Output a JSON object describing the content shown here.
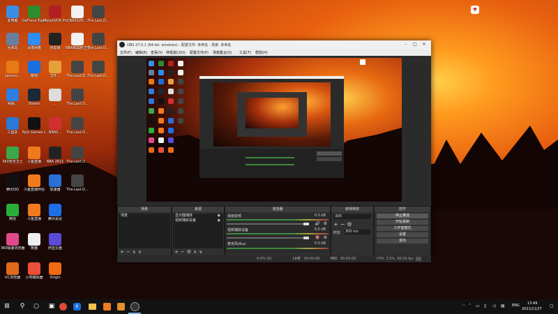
{
  "desktop": {
    "icons": [
      {
        "label": "此电脑",
        "icon": "computer-icon",
        "color": "#3a8ee6"
      },
      {
        "label": "GeForce Experience",
        "icon": "nvidia-icon",
        "color": "#2e8b2e"
      },
      {
        "label": "MorphVOX Pro",
        "icon": "morphvox-icon",
        "color": "#b02020"
      },
      {
        "label": "CBA2020-...",
        "icon": "file-icon",
        "color": "#f2f2f2"
      },
      {
        "label": "The.Last.D...",
        "icon": "video-file-icon",
        "color": "#444444"
      },
      {
        "label": "回收站",
        "icon": "recycle-bin-icon",
        "color": "#6a7fa0"
      },
      {
        "label": "百度网盘",
        "icon": "baidu-netdisk-icon",
        "color": "#2f8cf0"
      },
      {
        "label": "快剪辑",
        "icon": "kuaijianji-icon",
        "color": "#222222"
      },
      {
        "label": "NBA和其他卫生",
        "icon": "file-icon",
        "color": "#f2f2f2"
      },
      {
        "label": "The.Last.D...",
        "icon": "video-file-icon",
        "color": "#444444"
      },
      {
        "label": "Lenovo...",
        "icon": "app-icon",
        "color": "#e87a14"
      },
      {
        "label": "酷狗",
        "icon": "kugou-icon",
        "color": "#1a6fe0"
      },
      {
        "label": "文件...",
        "icon": "app-icon",
        "color": "#e6a03a"
      },
      {
        "label": "The.Last.D...",
        "icon": "video-file-icon",
        "color": "#444444"
      },
      {
        "label": "The.Last.D...",
        "icon": "video-file-icon",
        "color": "#444444"
      },
      {
        "label": "网易...",
        "icon": "app-icon",
        "color": "#2f7de0"
      },
      {
        "label": "Steam",
        "icon": "steam-icon",
        "color": "#1b2838"
      },
      {
        "label": "...",
        "icon": "anime-icon",
        "color": "#dddddd"
      },
      {
        "label": "The.Last.D...",
        "icon": "video-file-icon",
        "color": "#444444"
      },
      {
        "label": "三国杀",
        "icon": "app-icon",
        "color": "#2b78d6"
      },
      {
        "label": "Epic Games Launcher",
        "icon": "epic-icon",
        "color": "#111111"
      },
      {
        "label": "NBA2...",
        "icon": "app-icon",
        "color": "#d03030"
      },
      {
        "label": "The.Last.D...",
        "icon": "video-file-icon",
        "color": "#444444"
      },
      {
        "label": "360安全卫士",
        "icon": "360-icon",
        "color": "#3aa84a"
      },
      {
        "label": "斗鱼直播",
        "icon": "douyu-icon",
        "color": "#f07a1e"
      },
      {
        "label": "NBA 2K21",
        "icon": "nba2k-icon",
        "color": "#222222"
      },
      {
        "label": "The.Last.D...",
        "icon": "video-file-icon",
        "color": "#444444"
      },
      {
        "label": "腾讯QQ",
        "icon": "qq-icon",
        "color": "#111111"
      },
      {
        "label": "斗鱼直播伴侣",
        "icon": "douyu-icon",
        "color": "#f07a1e"
      },
      {
        "label": "加速器",
        "icon": "app-icon",
        "color": "#2a6fd8"
      },
      {
        "label": "The.Last.D...",
        "icon": "video-file-icon",
        "color": "#444444"
      },
      {
        "label": "微信",
        "icon": "wechat-icon",
        "color": "#2aae3a"
      },
      {
        "label": "斗鱼直播",
        "icon": "douyu-icon",
        "color": "#f07a1e"
      },
      {
        "label": "腾讯会议",
        "icon": "tencent-meeting-icon",
        "color": "#1e6ee6"
      },
      {
        "label": "360极速浏览器",
        "icon": "360-browser-icon",
        "color": "#e04a8a"
      },
      {
        "label": "熊猫",
        "icon": "panda-icon",
        "color": "#eeeeee"
      },
      {
        "label": "阿里云盘",
        "icon": "aliyun-icon",
        "color": "#5a4ad6"
      },
      {
        "label": "UC浏览器",
        "icon": "uc-icon",
        "color": "#e06a1a"
      },
      {
        "label": "小鸡模拟器",
        "icon": "app-icon",
        "color": "#e8503a"
      },
      {
        "label": "Origin",
        "icon": "origin-icon",
        "color": "#f06a14"
      }
    ],
    "tshirt": {
      "icon": "tshirt-icon"
    }
  },
  "obs": {
    "title": "OBS 27.0.1 (64-bit, windows) - 配置文件: 未命名 - 场景: 未命名",
    "menu": [
      "文件(F)",
      "编辑(E)",
      "查看(V)",
      "停靠窗口(D)",
      "配置文件(P)",
      "场景集合(S)",
      "工具(T)",
      "帮助(H)"
    ],
    "docks": {
      "scenes": {
        "title": "场景",
        "items": [
          "场景"
        ]
      },
      "sources": {
        "title": "来源",
        "items": [
          "显示器捕获",
          "视频捕获设备"
        ]
      },
      "mixer": {
        "title": "混音器",
        "channels": [
          {
            "name": "桌面音频",
            "db": "0.0 dB"
          },
          {
            "name": "视频捕获设备",
            "db": "0.0 dB"
          },
          {
            "name": "麦克风/Aux",
            "db": "0.0 dB"
          }
        ]
      },
      "transitions": {
        "title": "转场特效",
        "type": "淡出",
        "duration_label": "时长",
        "duration": "300 ms"
      },
      "controls": {
        "title": "控件",
        "buttons": [
          "停止推流",
          "开始录制",
          "工作室模式",
          "设置",
          "退出"
        ]
      }
    },
    "status": {
      "dropped": "0.0% (0)",
      "live_label": "LIVE",
      "live": "00:00:00",
      "rec_label": "REC",
      "rec": "00:00:00",
      "cpu": "CPU: 3.5%, 60.00 fps"
    }
  },
  "taskbar": {
    "apps": [
      {
        "icon": "windows-start-icon"
      },
      {
        "icon": "search-icon"
      },
      {
        "icon": "task-view-icon"
      },
      {
        "icon": "chrome-icon"
      },
      {
        "icon": "kugou-icon"
      },
      {
        "icon": "file-explorer-icon"
      },
      {
        "icon": "douyu-icon"
      },
      {
        "icon": "app-icon"
      },
      {
        "icon": "obs-icon"
      }
    ],
    "tray": {
      "lang": "ENG",
      "time": "13:49",
      "date": "2021/11/27"
    }
  }
}
